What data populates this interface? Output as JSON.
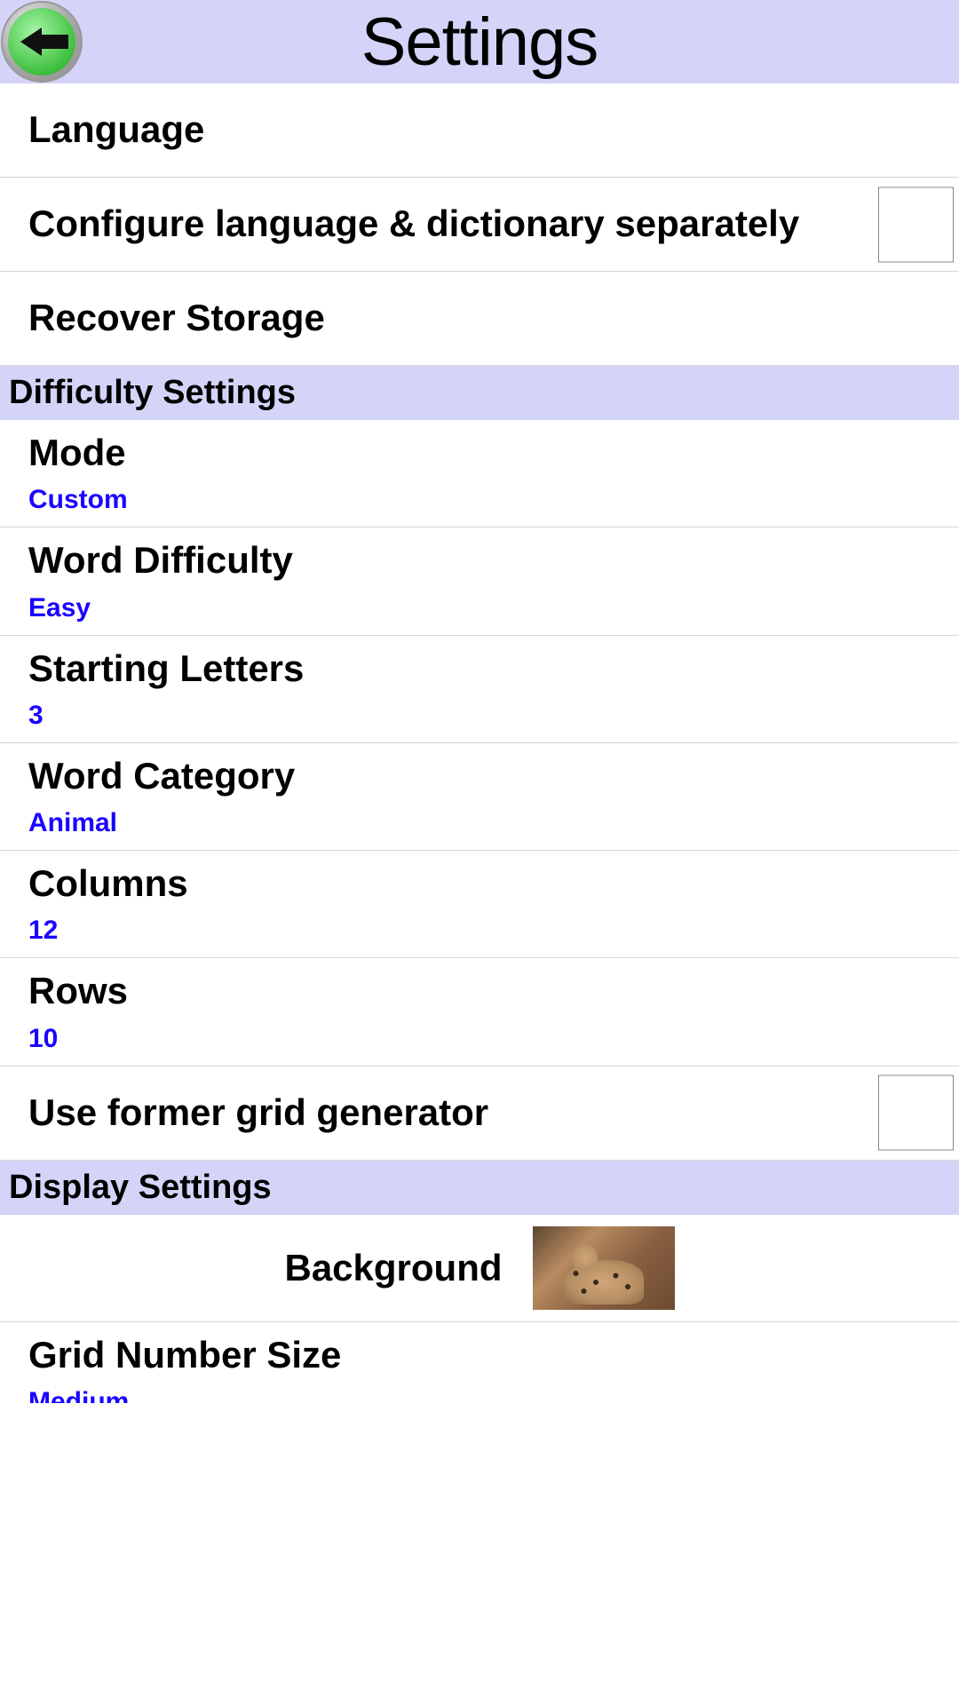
{
  "header": {
    "title": "Settings"
  },
  "rows": {
    "language": {
      "label": "Language"
    },
    "configure_lang": {
      "label": "Configure language & dictionary separately"
    },
    "recover_storage": {
      "label": "Recover Storage"
    }
  },
  "sections": {
    "difficulty": {
      "title": "Difficulty Settings"
    },
    "display": {
      "title": "Display Settings"
    }
  },
  "difficulty": {
    "mode": {
      "label": "Mode",
      "value": "Custom"
    },
    "word_difficulty": {
      "label": "Word Difficulty",
      "value": "Easy"
    },
    "starting_letters": {
      "label": "Starting Letters",
      "value": "3"
    },
    "word_category": {
      "label": "Word Category",
      "value": "Animal"
    },
    "columns": {
      "label": "Columns",
      "value": "12"
    },
    "rows": {
      "label": "Rows",
      "value": "10"
    },
    "use_former_grid": {
      "label": "Use former grid generator"
    }
  },
  "display": {
    "background": {
      "label": "Background"
    },
    "grid_number_size": {
      "label": "Grid Number Size",
      "value": "Medium"
    }
  }
}
